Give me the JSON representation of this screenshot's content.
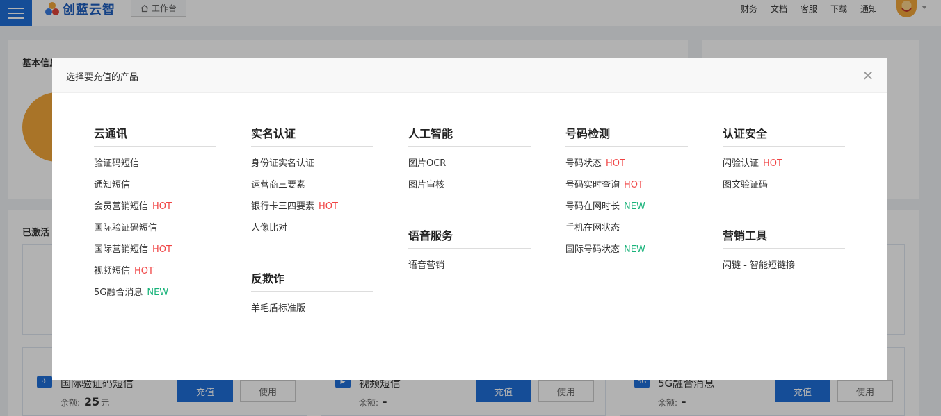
{
  "topnav": {
    "brand": "创蓝云智",
    "workbench": "工作台",
    "links": [
      "财务",
      "文档",
      "客服",
      "下载",
      "通知"
    ]
  },
  "background": {
    "basic_info_title": "基本信息",
    "activated_title": "已激活",
    "cards": [
      {
        "name": "国际验证码短信",
        "balance_label": "余额:",
        "balance": "25",
        "unit": "元",
        "recharge": "充值",
        "use": "使用"
      },
      {
        "name": "视频短信",
        "balance_label": "余额:",
        "balance": "-",
        "unit": "",
        "recharge": "充值",
        "use": "使用"
      },
      {
        "name": "5G融合消息",
        "balance_label": "余额:",
        "balance": "-",
        "unit": "",
        "recharge": "充值",
        "use": "使用"
      }
    ]
  },
  "modal": {
    "title": "选择要充值的产品",
    "columns": [
      [
        {
          "title": "云通讯",
          "items": [
            {
              "label": "验证码短信",
              "tag": ""
            },
            {
              "label": "通知短信",
              "tag": ""
            },
            {
              "label": "会员营销短信",
              "tag": "HOT"
            },
            {
              "label": "国际验证码短信",
              "tag": ""
            },
            {
              "label": "国际营销短信",
              "tag": "HOT"
            },
            {
              "label": "视频短信",
              "tag": "HOT"
            },
            {
              "label": "5G融合消息",
              "tag": "NEW"
            }
          ]
        }
      ],
      [
        {
          "title": "实名认证",
          "items": [
            {
              "label": "身份证实名认证",
              "tag": ""
            },
            {
              "label": "运营商三要素",
              "tag": ""
            },
            {
              "label": "银行卡三四要素",
              "tag": "HOT"
            },
            {
              "label": "人像比对",
              "tag": ""
            }
          ]
        },
        {
          "title": "反欺诈",
          "items": [
            {
              "label": "羊毛盾标准版",
              "tag": ""
            }
          ]
        }
      ],
      [
        {
          "title": "人工智能",
          "items": [
            {
              "label": "图片OCR",
              "tag": ""
            },
            {
              "label": "图片审核",
              "tag": ""
            }
          ]
        },
        {
          "title": "语音服务",
          "items": [
            {
              "label": "语音营销",
              "tag": ""
            }
          ]
        }
      ],
      [
        {
          "title": "号码检测",
          "items": [
            {
              "label": "号码状态",
              "tag": "HOT"
            },
            {
              "label": "号码实时查询",
              "tag": "HOT"
            },
            {
              "label": "号码在网时长",
              "tag": "NEW"
            },
            {
              "label": "手机在网状态",
              "tag": ""
            },
            {
              "label": "国际号码状态",
              "tag": "NEW"
            }
          ]
        }
      ],
      [
        {
          "title": "认证安全",
          "items": [
            {
              "label": "闪验认证",
              "tag": "HOT"
            },
            {
              "label": "图文验证码",
              "tag": ""
            }
          ]
        },
        {
          "title": "营销工具",
          "items": [
            {
              "label": "闪链 - 智能短链接",
              "tag": ""
            }
          ]
        }
      ]
    ]
  },
  "colors": {
    "primary": "#1f6fd8",
    "hot": "#f04444",
    "new": "#19b37a"
  }
}
